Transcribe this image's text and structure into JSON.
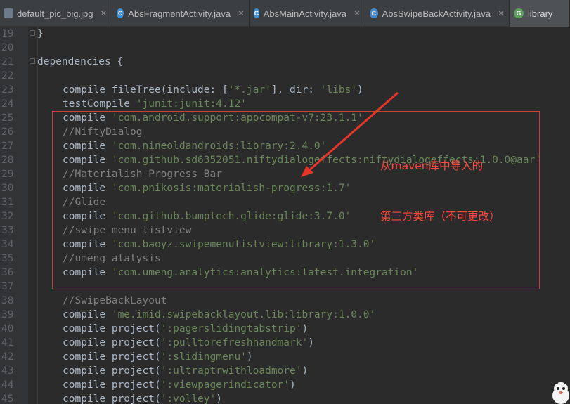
{
  "tabs": [
    {
      "label": "default_pic_big.jpg",
      "icon": "image-file-icon",
      "closable": true,
      "active": false
    },
    {
      "label": "AbsFragmentActivity.java",
      "icon": "java-class-icon",
      "closable": true,
      "active": false
    },
    {
      "label": "AbsMainActivity.java",
      "icon": "java-class-icon",
      "closable": true,
      "active": false
    },
    {
      "label": "AbsSwipeBackActivity.java",
      "icon": "class-icon",
      "closable": true,
      "active": false
    },
    {
      "label": "library",
      "icon": "gradle-icon",
      "closable": false,
      "active": true
    }
  ],
  "lines": [
    {
      "n": "19",
      "code": "}"
    },
    {
      "n": "20",
      "code": ""
    },
    {
      "n": "21",
      "code": "dependencies {"
    },
    {
      "n": "22",
      "code": ""
    },
    {
      "n": "23",
      "pre": "compile fileTree(include: [",
      "s1": "'*.jar'",
      "mid": "], dir: ",
      "s2": "'libs'",
      "post": ")"
    },
    {
      "n": "24",
      "pre": "testCompile ",
      "s1": "'junit:junit:4.12'"
    },
    {
      "n": "25",
      "pre": "compile ",
      "s1": "'com.android.support:appcompat-v7:23.1.1'"
    },
    {
      "n": "26",
      "comment": "//NiftyDialog"
    },
    {
      "n": "27",
      "pre": "compile ",
      "s1": "'com.nineoldandroids:library:2.4.0'"
    },
    {
      "n": "28",
      "pre": "compile ",
      "s1": "'com.github.sd6352051.niftydialogeffects:niftydialogeffects:1.0.0@aar'"
    },
    {
      "n": "29",
      "comment": "//Materialish Progress Bar"
    },
    {
      "n": "30",
      "pre": "compile ",
      "s1": "'com.pnikosis:materialish-progress:1.7'"
    },
    {
      "n": "31",
      "comment": "//Glide"
    },
    {
      "n": "32",
      "pre": "compile ",
      "s1": "'com.github.bumptech.glide:glide:3.7.0'"
    },
    {
      "n": "33",
      "comment": "//swipe menu listview"
    },
    {
      "n": "34",
      "pre": "compile ",
      "s1": "'com.baoyz.swipemenulistview:library:1.3.0'"
    },
    {
      "n": "35",
      "comment": "//umeng alalysis"
    },
    {
      "n": "36",
      "pre": "compile ",
      "s1": "'com.umeng.analytics:analytics:latest.integration'"
    },
    {
      "n": "37",
      "code": ""
    },
    {
      "n": "38",
      "comment": "//SwipeBackLayout"
    },
    {
      "n": "39",
      "pre": "compile ",
      "s1": "'me.imid.swipebacklayout.lib:library:1.0.0'"
    },
    {
      "n": "40",
      "pre": "compile project(",
      "s1": "':pagerslidingtabstrip'",
      "post": ")"
    },
    {
      "n": "41",
      "pre": "compile project(",
      "s1": "':pulltorefreshhandmark'",
      "post": ")"
    },
    {
      "n": "42",
      "pre": "compile project(",
      "s1": "':slidingmenu'",
      "post": ")"
    },
    {
      "n": "43",
      "pre": "compile project(",
      "s1": "':ultraptrwithloadmore'",
      "post": ")"
    },
    {
      "n": "44",
      "pre": "compile project(",
      "s1": "':viewpagerindicator'",
      "post": ")"
    },
    {
      "n": "45",
      "pre": "compile project(",
      "s1": "':volley'",
      "post": ")"
    }
  ],
  "annotation": {
    "line1": "从maven库中导入的",
    "line2": "第三方类库（不可更改）",
    "color": "#ff4a3d"
  },
  "colors": {
    "background": "#2b2b2b",
    "string": "#6a8759",
    "comment": "#808080",
    "text": "#a9b7c6",
    "annotation_box": "#d23c3c"
  }
}
